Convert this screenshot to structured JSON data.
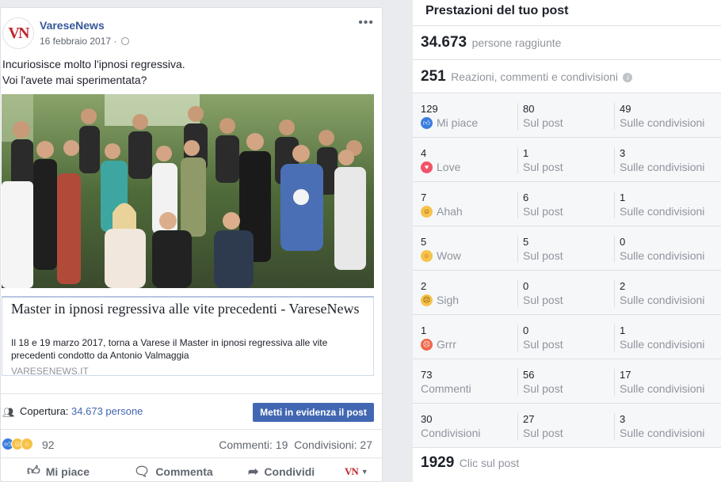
{
  "post": {
    "page_name": "VareseNews",
    "avatar_text": "VN",
    "date": "16 febbraio 2017",
    "date_separator": "·",
    "text_line1": "Incuriosisce molto l'ipnosi regressiva.",
    "text_line2": "Voi l'avete mai sperimentata?",
    "link": {
      "title": "Master in ipnosi regressiva alle vite precedenti - VareseNews",
      "description": "Il 18 e 19 marzo 2017, torna a Varese il Master in ipnosi regressiva alle vite precedenti condotto da Antonio Valmaggia",
      "domain": "VARESENEWS.IT"
    },
    "coverage_label": "Copertura:",
    "coverage_value": "34.673 persone",
    "boost_label": "Metti in evidenza il post",
    "reaction_total": "92",
    "comments": "Commenti: 19",
    "shares": "Condivisioni: 27",
    "actions": {
      "like": "Mi piace",
      "comment": "Commenta",
      "share": "Condividi"
    }
  },
  "stats": {
    "title": "Prestazioni del tuo post",
    "reach_value": "34.673",
    "reach_label": "persone raggiunte",
    "engagement_value": "251",
    "engagement_label": "Reazioni, commenti e condivisioni",
    "rows": [
      {
        "total": "129",
        "label": "Mi piace",
        "icon": "like-icon",
        "post": "80",
        "post_label": "Sul post",
        "shares": "49",
        "shares_label": "Sulle condivisioni"
      },
      {
        "total": "4",
        "label": "Love",
        "icon": "love-icon",
        "post": "1",
        "post_label": "Sul post",
        "shares": "3",
        "shares_label": "Sulle condivisioni"
      },
      {
        "total": "7",
        "label": "Ahah",
        "icon": "haha-icon",
        "post": "6",
        "post_label": "Sul post",
        "shares": "1",
        "shares_label": "Sulle condivisioni"
      },
      {
        "total": "5",
        "label": "Wow",
        "icon": "wow-icon",
        "post": "5",
        "post_label": "Sul post",
        "shares": "0",
        "shares_label": "Sulle condivisioni"
      },
      {
        "total": "2",
        "label": "Sigh",
        "icon": "sad-icon",
        "post": "0",
        "post_label": "Sul post",
        "shares": "2",
        "shares_label": "Sulle condivisioni"
      },
      {
        "total": "1",
        "label": "Grrr",
        "icon": "angry-icon",
        "post": "0",
        "post_label": "Sul post",
        "shares": "1",
        "shares_label": "Sulle condivisioni"
      },
      {
        "total": "73",
        "label": "Commenti",
        "icon": "",
        "post": "56",
        "post_label": "Sul post",
        "shares": "17",
        "shares_label": "Sulle condivisioni"
      },
      {
        "total": "30",
        "label": "Condivisioni",
        "icon": "",
        "post": "27",
        "post_label": "Sul post",
        "shares": "3",
        "shares_label": "Sulle condivisioni"
      }
    ],
    "clicks_value": "1929",
    "clicks_label": "Clic sul post"
  },
  "colors": {
    "facebook_blue": "#4267b2",
    "link_blue": "#365899",
    "brand_red": "#c0272d"
  }
}
